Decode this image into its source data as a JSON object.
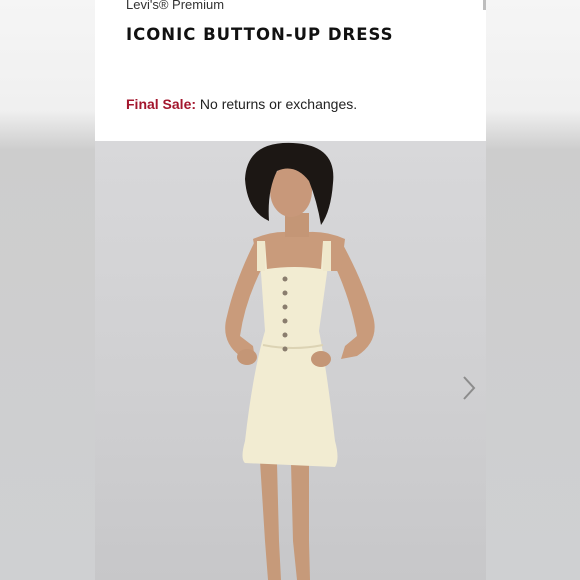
{
  "product": {
    "brand": "Levi's® Premium",
    "title": "ICONIC BUTTON-UP DRESS",
    "sale_label": "Final Sale:",
    "sale_text": " No returns or exchanges."
  },
  "gallery": {
    "next_icon": "chevron-right-icon"
  },
  "colors": {
    "sale_label": "#a3162d",
    "dress": "#f2ecd2"
  }
}
